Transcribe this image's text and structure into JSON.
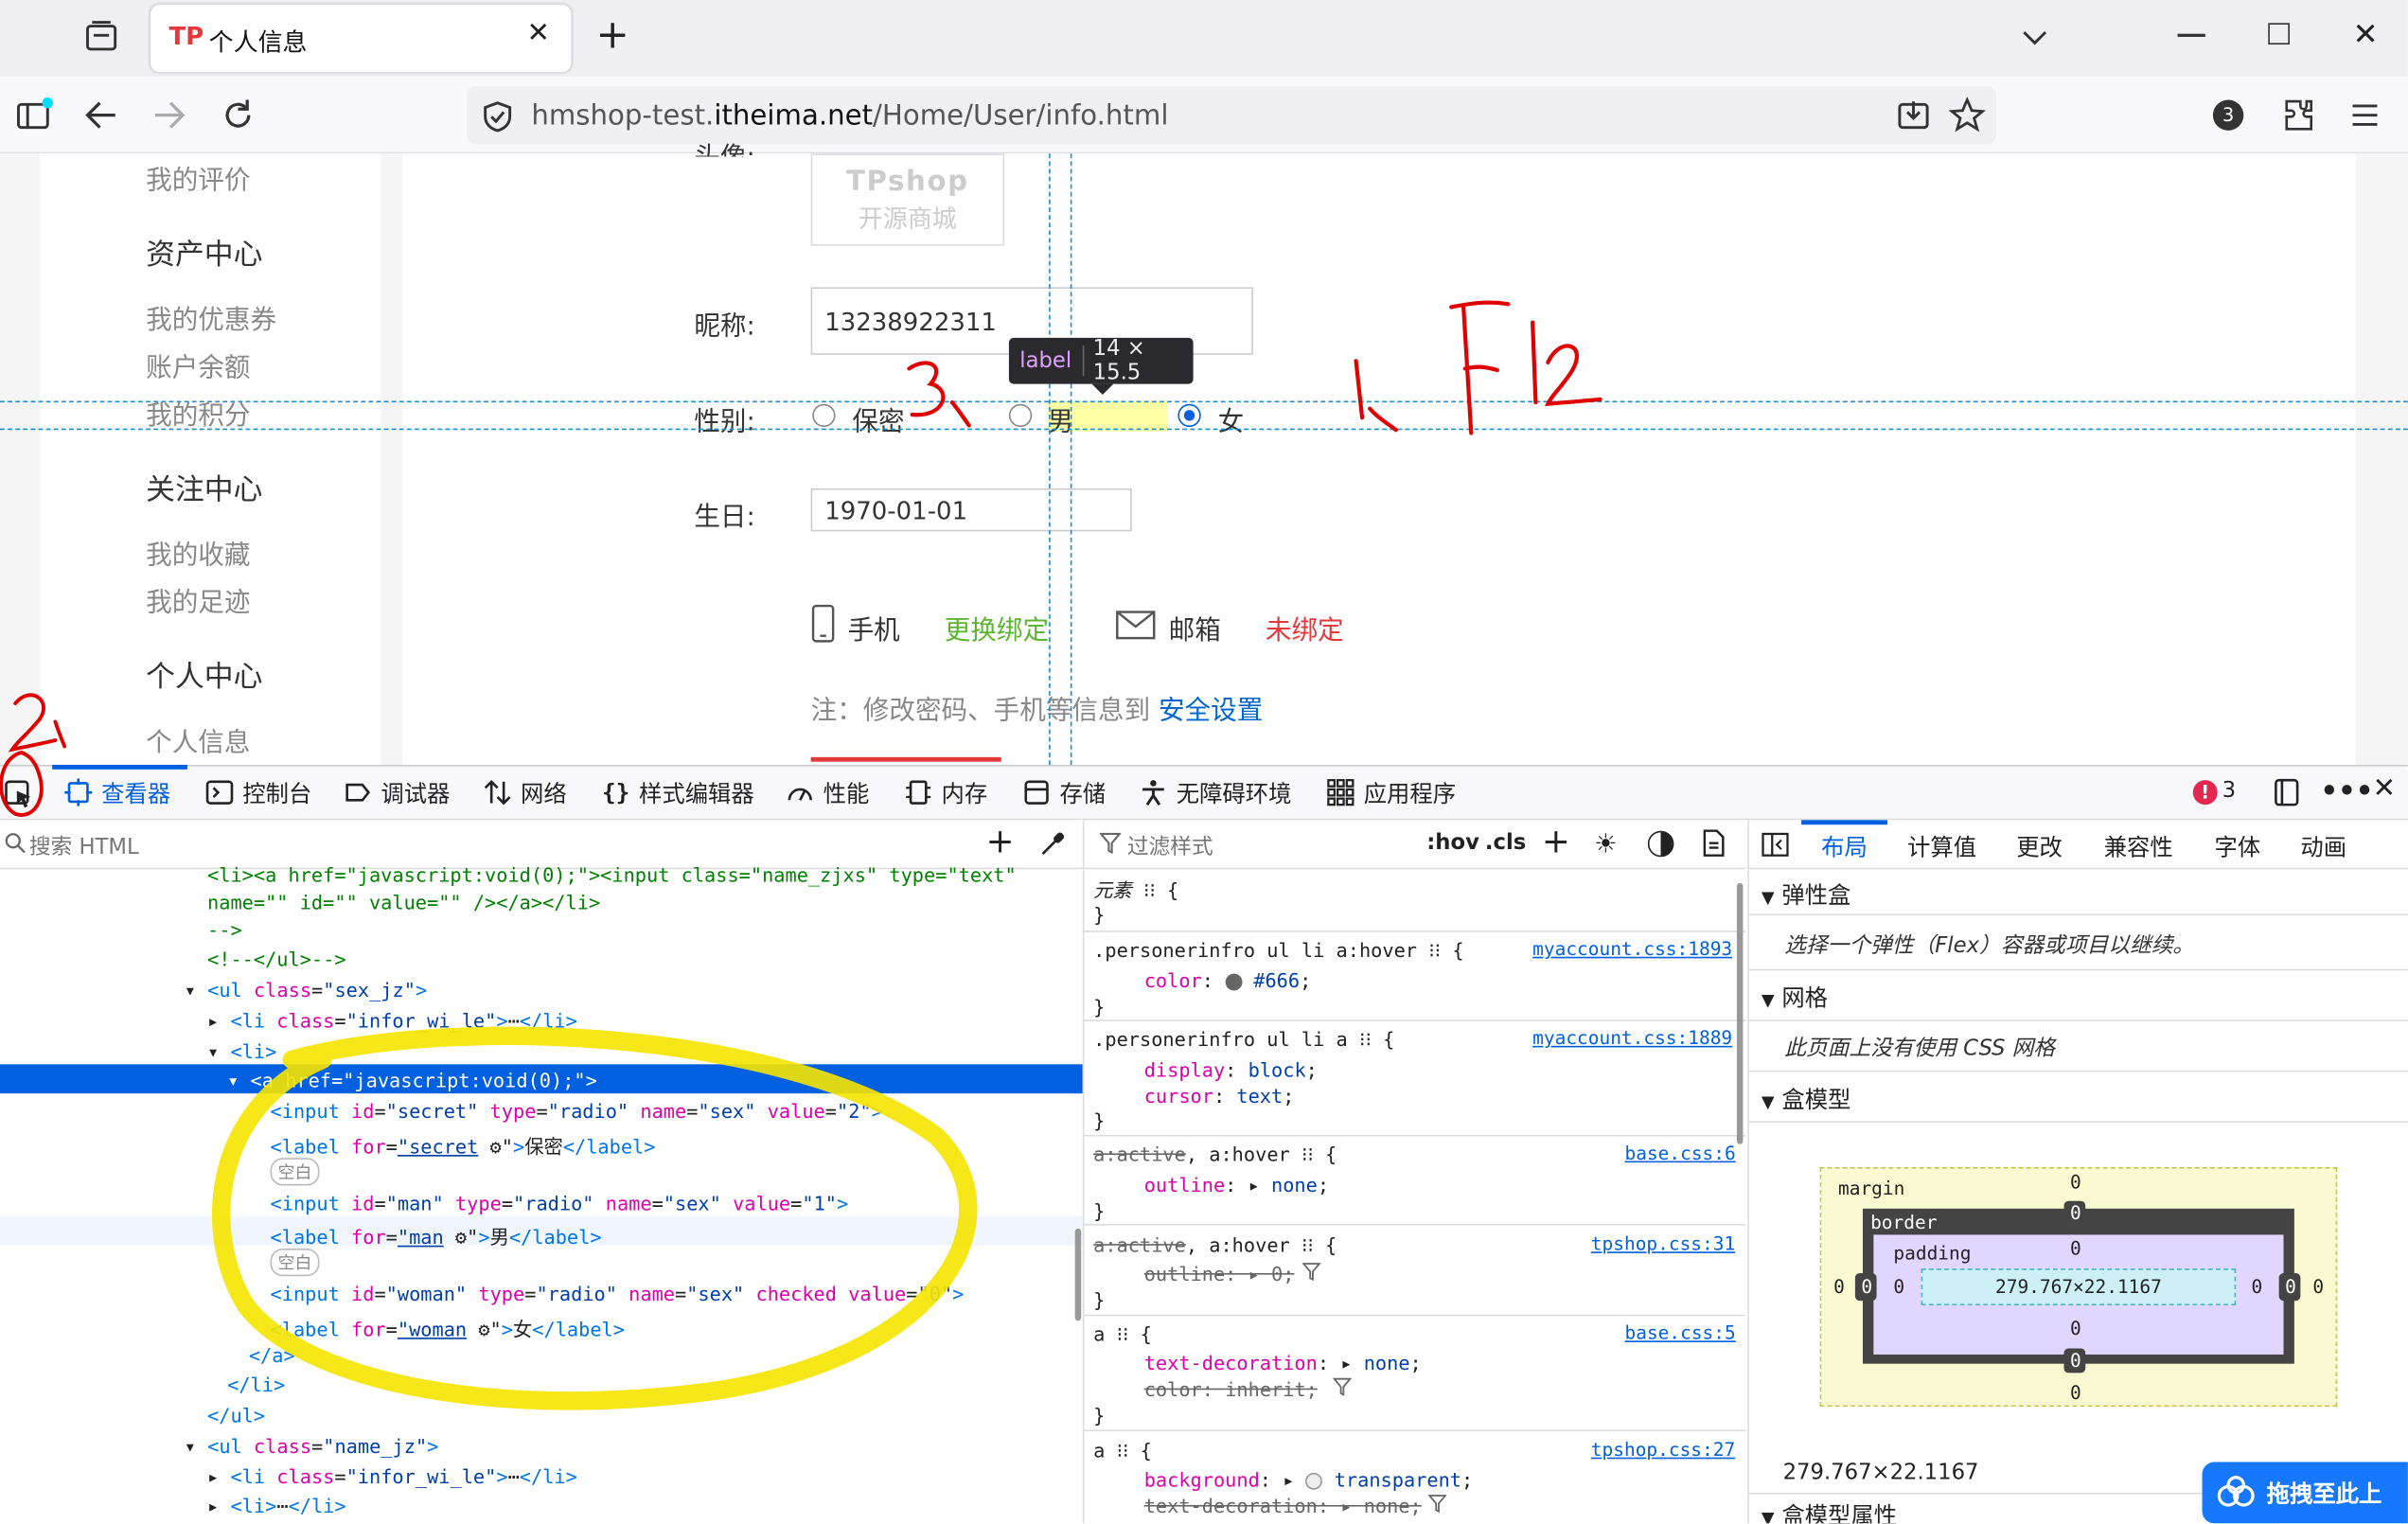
{
  "browser": {
    "tab_title": "个人信息",
    "tab_logo": "TP",
    "url_prefix": "hmshop-test.",
    "url_host": "itheima.net",
    "url_path": "/Home/User/info.html",
    "badge_count": "3"
  },
  "sidebar": {
    "top_item": "我的评价",
    "sections": [
      {
        "title": "资产中心",
        "items": [
          "我的优惠券",
          "账户余额",
          "我的积分"
        ]
      },
      {
        "title": "关注中心",
        "items": [
          "我的收藏",
          "我的足迹"
        ]
      },
      {
        "title": "个人中心",
        "items": [
          "个人信息"
        ]
      }
    ]
  },
  "form": {
    "avatar_label": "头像:",
    "logo_line1": "TPshop",
    "logo_line2": "开源商城",
    "nickname_label": "昵称:",
    "nickname_value": "13238922311",
    "gender_label": "性别:",
    "gender_options": [
      "保密",
      "男",
      "女"
    ],
    "gender_checked": "女",
    "birthday_label": "生日:",
    "birthday_value": "1970-01-01",
    "phone_label": "手机",
    "phone_action": "更换绑定",
    "email_label": "邮箱",
    "email_status": "未绑定",
    "note_prefix": "注：修改密码、手机等信息到",
    "note_link": "安全设置"
  },
  "tooltip": {
    "tag": "label",
    "size": "14 × 15.5"
  },
  "annotations": {
    "a1": "1、F12",
    "a2": "2、",
    "a3": "3、"
  },
  "devtools": {
    "tabs": [
      "查看器",
      "控制台",
      "调试器",
      "网络",
      "样式编辑器",
      "性能",
      "内存",
      "存储",
      "无障碍环境",
      "应用程序"
    ],
    "active_tab": "查看器",
    "error_count": "3",
    "search_placeholder": "搜索 HTML",
    "filter_placeholder": "过滤样式",
    "hov": ":hov",
    "cls": ".cls",
    "right_tabs": [
      "布局",
      "计算值",
      "更改",
      "兼容性",
      "字体",
      "动画"
    ],
    "layout": {
      "flex_title": "弹性盒",
      "flex_note": "选择一个弹性（Flex）容器或项目以继续。",
      "grid_title": "网格",
      "grid_note": "此页面上没有使用 CSS 网格",
      "box_title": "盒模型",
      "box_props_title": "盒模型属性",
      "margin": "margin",
      "border": "border",
      "padding": "padding",
      "zero": "0",
      "content_size": "279.767×22.1167",
      "size_below": "279.767×22.1167"
    },
    "drag_button": "拖拽至此上",
    "element_rule": "元素",
    "whitespace": "空白",
    "css_links": [
      "myaccount.css:1893",
      "myaccount.css:1889",
      "base.css:6",
      "tpshop.css:31",
      "base.css:5",
      "tpshop.css:27"
    ],
    "css_rules": {
      "r1_sel": ".personerinfro ul li a:hover",
      "r1_p": "color",
      "r1_v": "#666",
      "r2_sel": ".personerinfro ul li a",
      "r2_p1": "display",
      "r2_v1": "block",
      "r2_p2": "cursor",
      "r2_v2": "text",
      "r3_sel_a": "a:active",
      "r3_sel_b": ", a:hover",
      "r3_p": "outline",
      "r3_v": "none",
      "r4_sel_a": "a:active",
      "r4_sel_b": ", a:hover",
      "r4_p": "outline",
      "r4_v": "0",
      "r5_sel": "a",
      "r5_p1": "text-decoration",
      "r5_v1": "none",
      "r5_p2": "color",
      "r5_v2": "inherit",
      "r6_sel": "a",
      "r6_p1": "background",
      "r6_v1": "transparent",
      "r6_p2": "text-decoration",
      "r6_v2": "none"
    }
  }
}
